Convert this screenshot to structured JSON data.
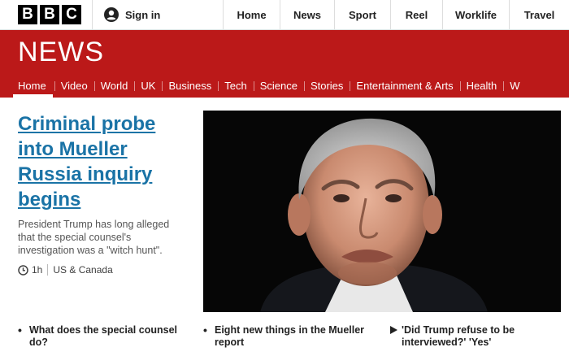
{
  "brand": {
    "letters": [
      "B",
      "B",
      "C"
    ]
  },
  "account": {
    "signin_label": "Sign in",
    "icon": "user-icon"
  },
  "global_nav": [
    "Home",
    "News",
    "Sport",
    "Reel",
    "Worklife",
    "Travel"
  ],
  "news": {
    "title": "NEWS",
    "nav": [
      "Home",
      "Video",
      "World",
      "UK",
      "Business",
      "Tech",
      "Science",
      "Stories",
      "Entertainment & Arts",
      "Health",
      "W"
    ]
  },
  "lead": {
    "headline": "Criminal probe into Mueller Russia inquiry begins",
    "summary": "President Trump has long alleged that the special counsel's investigation was a \"witch hunt\".",
    "time": "1h",
    "section": "US & Canada"
  },
  "related": [
    {
      "text": "What does the special counsel do?",
      "icon": "bullet"
    },
    {
      "text": "Eight new things in the Mueller report",
      "icon": "bullet"
    },
    {
      "text": "'Did Trump refuse to be interviewed?' 'Yes'",
      "icon": "play-icon"
    }
  ],
  "colors": {
    "brand_red": "#bb1919",
    "link_blue": "#1a73a6"
  }
}
